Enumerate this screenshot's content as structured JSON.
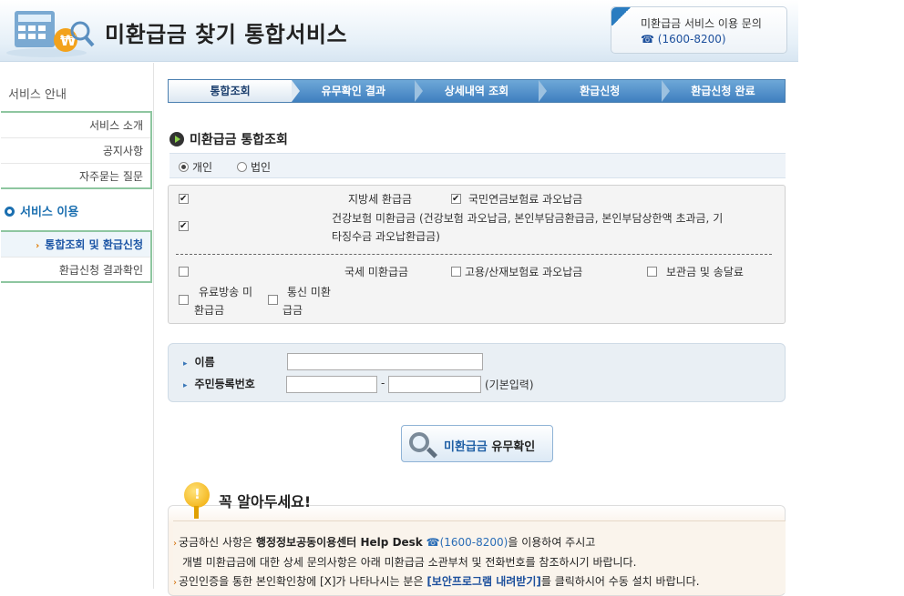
{
  "header": {
    "title": "미환급금 찾기 통합서비스",
    "help_line1": "미환급금 서비스 이용 문의",
    "help_line2": "☎ (1600-8200)"
  },
  "sidebar": {
    "section1_title": "서비스 안내",
    "items1": [
      "서비스 소개",
      "공지사항",
      "자주묻는 질문"
    ],
    "section2_title": "서비스 이용",
    "items2": [
      "통합조회 및 환급신청",
      "환급신청 결과확인"
    ],
    "active_item": "통합조회 및 환급신청"
  },
  "steps": [
    "통합조회",
    "유무확인 결과",
    "상세내역 조회",
    "환급신청",
    "환급신청 완료"
  ],
  "section_title": "미환급금 통합조회",
  "person_type": {
    "options": [
      "개인",
      "법인"
    ],
    "selected": "개인"
  },
  "checks": {
    "local_tax": "지방세 환급금",
    "pension": "국민연금보험료 과오납금",
    "health": "건강보험 미환급금 (건강보험 과오납금, 본인부담금환급금, 본인부담상한액 초과금, 기",
    "health2": "타징수금 과오납환급금)",
    "national_tax": "국세 미환급금",
    "employment": "고용/산재보험료 과오납금",
    "deposit": "보관금 및 송달료",
    "broadcast1": "유료방송 미",
    "broadcast2": "환급금",
    "telecom1": "통신 미환",
    "telecom2": "급금"
  },
  "form": {
    "name_label": "이름",
    "id_label": "주민등록번호",
    "separator": "-",
    "hint": "(기본입력)"
  },
  "search_button": {
    "highlight": "미환급금",
    "rest": " 유무확인"
  },
  "notice": {
    "title": "꼭 알아두세요!",
    "l1a": "궁금하신 사항은 ",
    "l1b": "행정정보공동이용센터 Help Desk",
    "l1c": "(1600-8200)",
    "l1d": "을 이용하여 주시고",
    "l2": "개별 미환급금에 대한 상세 문의사항은 아래 미환급금 소관부처 및 전화번호를 참조하시기 바랍니다.",
    "l3a": "공인인증을 통한 본인확인창에 [X]가 나타나시는 분은 ",
    "l3b": "[보안프로그램 내려받기]",
    "l3c": "를 클릭하시어 수동 설치 바랍니다."
  }
}
